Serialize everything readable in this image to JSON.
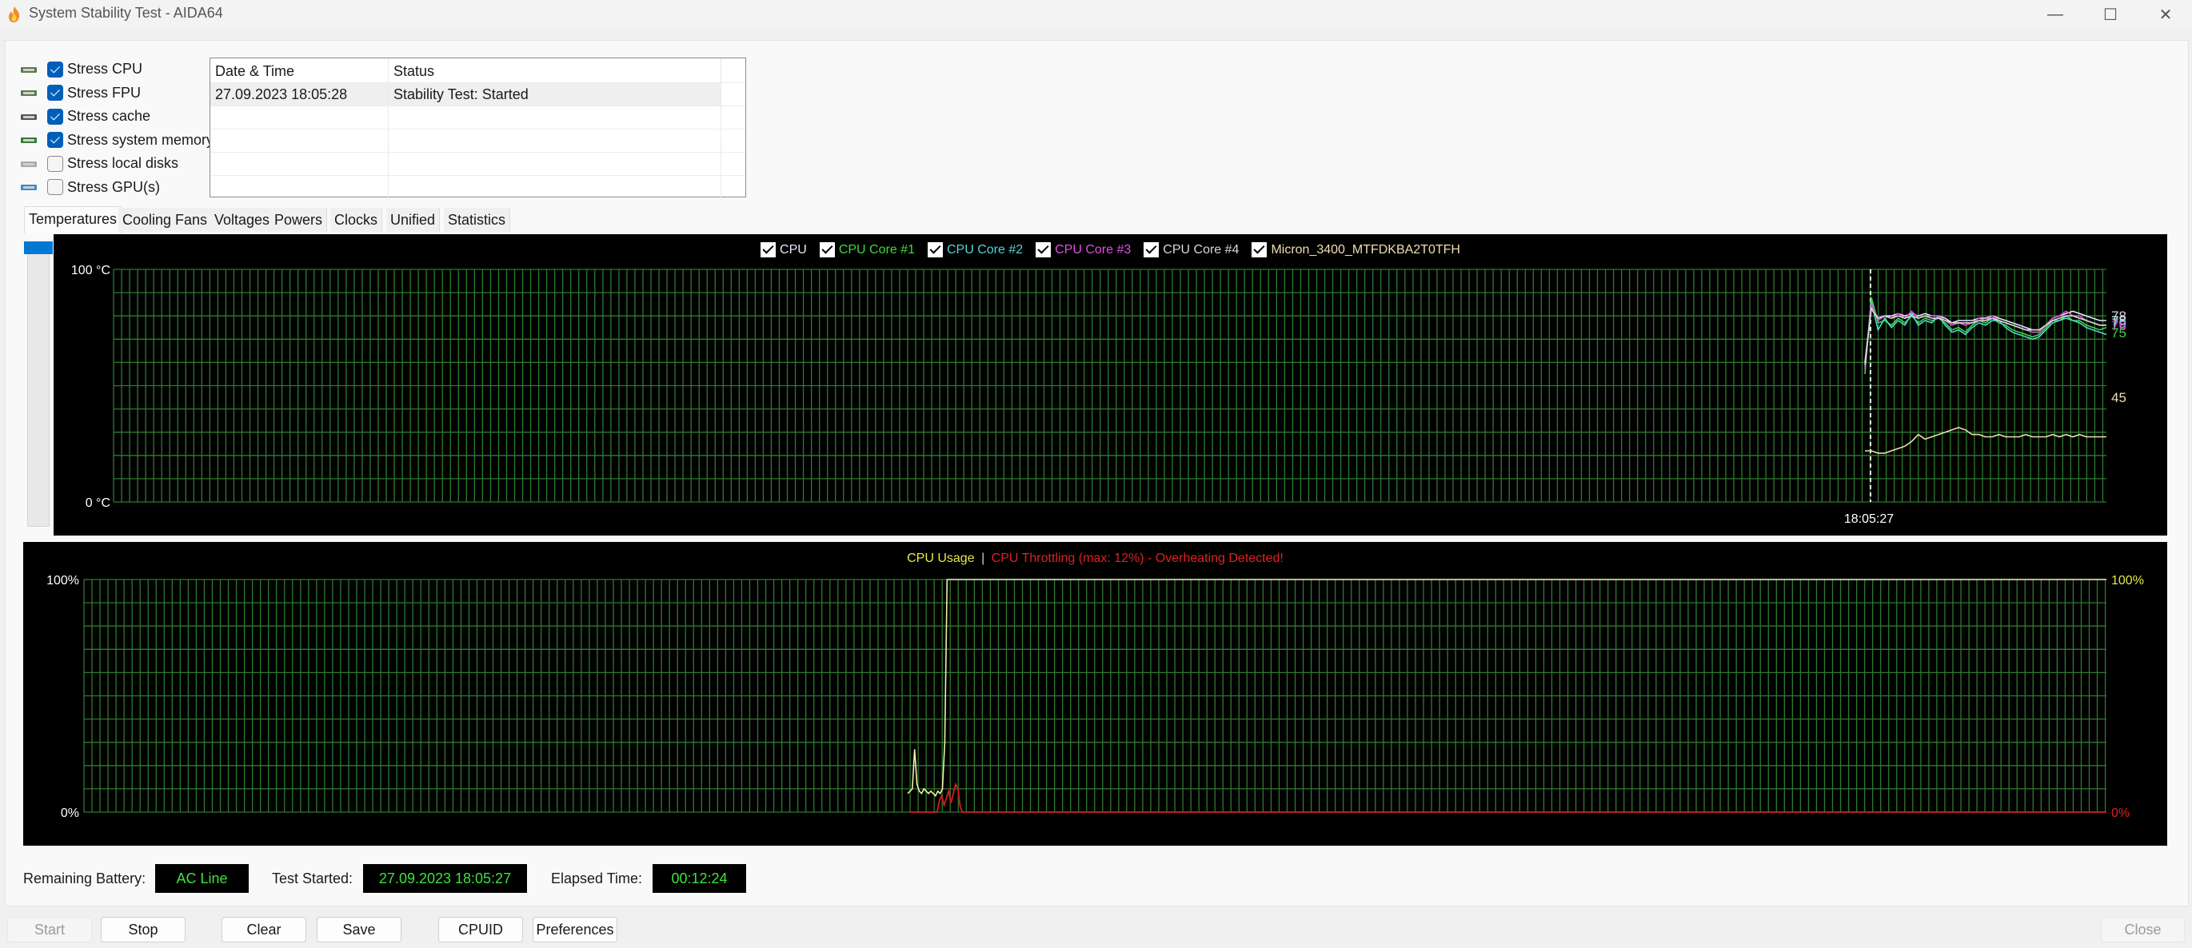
{
  "window": {
    "title": "System Stability Test - AIDA64",
    "minimize_label": "—",
    "maximize_label": "☐",
    "close_label": "✕"
  },
  "stress_options": [
    {
      "label": "Stress CPU",
      "checked": true,
      "icon": "cpu-chip-icon"
    },
    {
      "label": "Stress FPU",
      "checked": true,
      "icon": "fpu-chip-icon"
    },
    {
      "label": "Stress cache",
      "checked": true,
      "icon": "cache-chip-icon"
    },
    {
      "label": "Stress system memory",
      "checked": true,
      "icon": "memory-module-icon"
    },
    {
      "label": "Stress local disks",
      "checked": false,
      "icon": "disk-drive-icon"
    },
    {
      "label": "Stress GPU(s)",
      "checked": false,
      "icon": "gpu-card-icon"
    }
  ],
  "log": {
    "columns": [
      "Date & Time",
      "Status"
    ],
    "rows": [
      [
        "27.09.2023 18:05:28",
        "Stability Test: Started"
      ],
      [
        "",
        ""
      ],
      [
        "",
        ""
      ],
      [
        "",
        ""
      ],
      [
        "",
        ""
      ]
    ]
  },
  "tabs": [
    {
      "label": "Temperatures",
      "active": true
    },
    {
      "label": "Cooling Fans",
      "active": false
    },
    {
      "label": "Voltages",
      "active": false
    },
    {
      "label": "Powers",
      "active": false
    },
    {
      "label": "Clocks",
      "active": false
    },
    {
      "label": "Unified",
      "active": false
    },
    {
      "label": "Statistics",
      "active": false
    }
  ],
  "status": {
    "battery_label": "Remaining Battery:",
    "battery_value": "AC Line",
    "started_label": "Test Started:",
    "started_value": "27.09.2023 18:05:27",
    "elapsed_label": "Elapsed Time:",
    "elapsed_value": "00:12:24"
  },
  "buttons": {
    "start": "Start",
    "stop": "Stop",
    "clear": "Clear",
    "save": "Save",
    "cpuid": "CPUID",
    "preferences": "Preferences",
    "close": "Close"
  },
  "chart_data": [
    {
      "type": "line",
      "title": "Temperatures",
      "ylabel": "°C",
      "ylim": [
        0,
        100
      ],
      "ytick_labels": [
        "100 °C",
        "0 °C"
      ],
      "marker_time": "18:05:27",
      "grid": true,
      "legend_position": "top-center",
      "series": [
        {
          "name": "CPU",
          "color": "#e8e8ff",
          "checked": true,
          "last_value": 78,
          "values": [
            60,
            84,
            79,
            80,
            80,
            81,
            80,
            81,
            80,
            81,
            80,
            80,
            79,
            77,
            78,
            78,
            78,
            79,
            79,
            80,
            79,
            78,
            77,
            76,
            75,
            74,
            74,
            76,
            79,
            80,
            81,
            82,
            81,
            80,
            79,
            78,
            78
          ]
        },
        {
          "name": "CPU Core #1",
          "color": "#3ed93e",
          "checked": true,
          "last_value": 75,
          "values": [
            55,
            88,
            77,
            78,
            76,
            79,
            77,
            80,
            77,
            79,
            78,
            79,
            77,
            74,
            75,
            73,
            76,
            78,
            77,
            79,
            77,
            76,
            74,
            73,
            72,
            71,
            72,
            75,
            78,
            78,
            80,
            78,
            78,
            76,
            75,
            74,
            75
          ]
        },
        {
          "name": "CPU Core #2",
          "color": "#4fd6d6",
          "checked": true,
          "last_value": 79,
          "values": [
            58,
            86,
            74,
            79,
            75,
            78,
            76,
            81,
            76,
            78,
            77,
            80,
            76,
            73,
            74,
            72,
            75,
            77,
            76,
            78,
            78,
            75,
            73,
            72,
            71,
            70,
            71,
            74,
            77,
            78,
            79,
            78,
            77,
            75,
            74,
            73,
            72
          ]
        },
        {
          "name": "CPU Core #3",
          "color": "#e050e0",
          "checked": true,
          "last_value": 76,
          "values": [
            57,
            85,
            78,
            80,
            79,
            81,
            79,
            82,
            79,
            80,
            80,
            80,
            78,
            76,
            77,
            76,
            77,
            79,
            78,
            80,
            78,
            77,
            76,
            75,
            74,
            73,
            73,
            76,
            79,
            80,
            82,
            80,
            80,
            78,
            77,
            76,
            76
          ]
        },
        {
          "name": "CPU Core #4",
          "color": "#d8d8d8",
          "checked": true,
          "last_value": 78,
          "values": [
            59,
            83,
            79,
            80,
            79,
            80,
            79,
            80,
            79,
            80,
            79,
            79,
            78,
            77,
            77,
            77,
            77,
            78,
            78,
            79,
            78,
            77,
            76,
            75,
            74,
            74,
            74,
            76,
            78,
            79,
            80,
            80,
            79,
            78,
            77,
            76,
            76
          ]
        },
        {
          "name": "Micron_3400_MTFDKBA2T0TFH",
          "color": "#f0deb0",
          "checked": true,
          "last_value": 45,
          "values": [
            22,
            22,
            21,
            21,
            22,
            23,
            24,
            26,
            29,
            27,
            28,
            29,
            30,
            31,
            32,
            31,
            29,
            29,
            28,
            28,
            29,
            28,
            28,
            28,
            29,
            28,
            28,
            28,
            29,
            28,
            29,
            28,
            29,
            28,
            28,
            28,
            28
          ]
        }
      ]
    },
    {
      "type": "line",
      "title": "CPU Usage",
      "title_color": "#e8e84a",
      "subtitle": "CPU Throttling (max: 12%) - Overheating Detected!",
      "subtitle_color": "#e02020",
      "separator": "|",
      "ylim": [
        0,
        100
      ],
      "ytick_labels": [
        "100%",
        "0%"
      ],
      "right_labels": {
        "top": "100%",
        "bottom": "0%"
      },
      "grid": true,
      "series": [
        {
          "name": "CPU Usage",
          "color": "#f0f0a8",
          "values": [
            8,
            9,
            10,
            27,
            12,
            9,
            8,
            10,
            9,
            8,
            9,
            8,
            7,
            9,
            8,
            10,
            30,
            100,
            100,
            100,
            100,
            100,
            100
          ]
        },
        {
          "name": "CPU Throttling",
          "color": "#d02020",
          "values": [
            0,
            0,
            0,
            0,
            0,
            0,
            0,
            0,
            0,
            0,
            0,
            0,
            0,
            5,
            7,
            3,
            6,
            9,
            4,
            8,
            12,
            10,
            2,
            0,
            0,
            0,
            0,
            0,
            0,
            0
          ]
        }
      ]
    }
  ]
}
